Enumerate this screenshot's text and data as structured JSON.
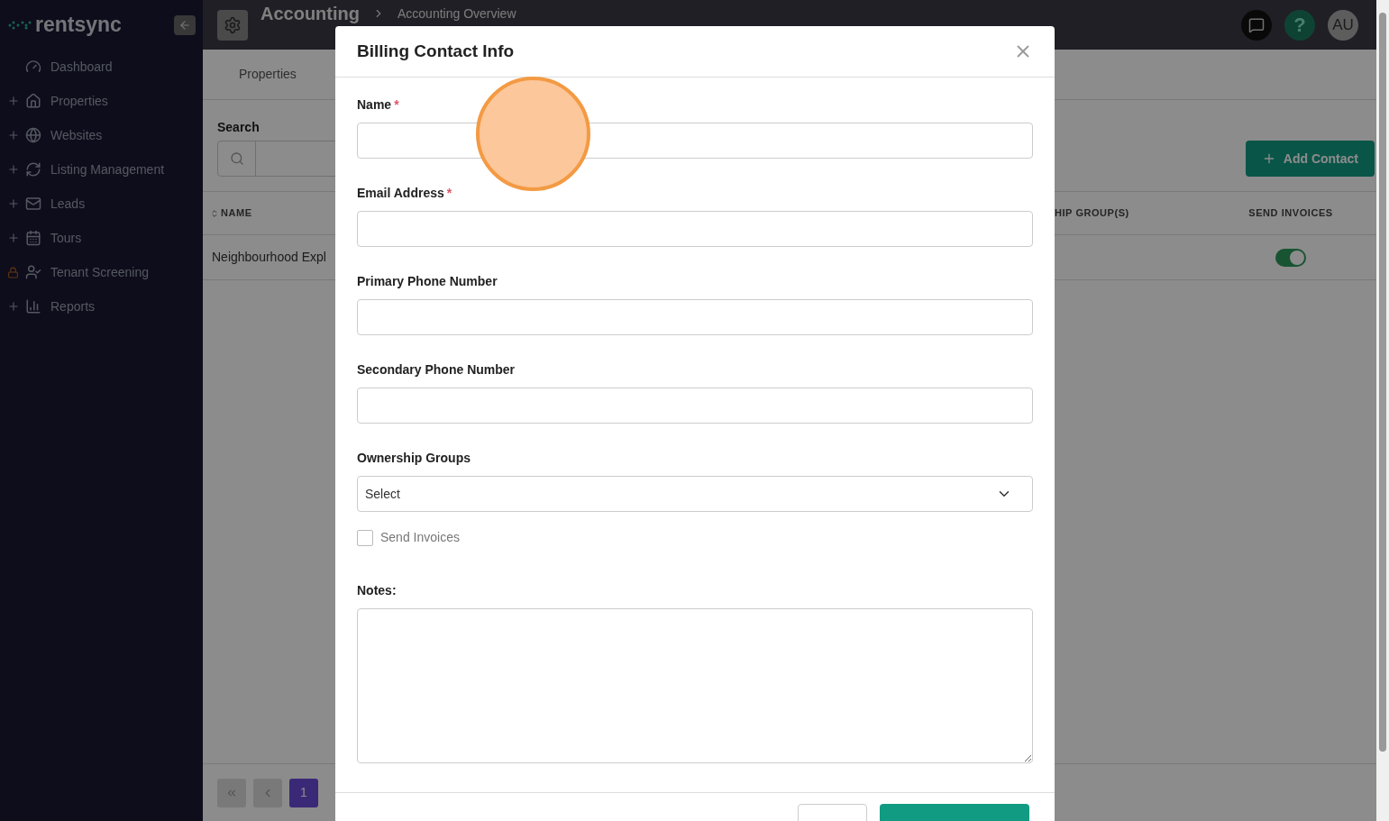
{
  "sidebar": {
    "logo": "rentsync",
    "items": [
      {
        "label": "Dashboard",
        "kind": "plain"
      },
      {
        "label": "Properties",
        "kind": "expandable"
      },
      {
        "label": "Websites",
        "kind": "expandable"
      },
      {
        "label": "Listing Management",
        "kind": "expandable"
      },
      {
        "label": "Leads",
        "kind": "expandable"
      },
      {
        "label": "Tours",
        "kind": "expandable"
      },
      {
        "label": "Tenant Screening",
        "kind": "locked"
      },
      {
        "label": "Reports",
        "kind": "expandable"
      }
    ]
  },
  "header": {
    "title": "Accounting",
    "breadcrumb": "Accounting Overview",
    "help": "?",
    "avatar": "AU"
  },
  "tabs": [
    {
      "label": "Properties",
      "selected": false
    }
  ],
  "search": {
    "label": "Search"
  },
  "add_button": "Add Contact",
  "table": {
    "columns": [
      "NAME",
      "HIP GROUP(S)",
      "SEND INVOICES"
    ],
    "rows": [
      {
        "name": "Neighbourhood Expl",
        "send_invoices": true
      }
    ]
  },
  "pagination": {
    "pages": [
      {
        "label": "1",
        "selected": true
      }
    ]
  },
  "modal": {
    "title": "Billing Contact Info",
    "fields": [
      {
        "label": "Name",
        "required_mark": "*",
        "kind": "input"
      },
      {
        "label": "Email Address",
        "required_mark": "*",
        "kind": "input"
      },
      {
        "label": "Primary Phone Number",
        "kind": "input"
      },
      {
        "label": "Secondary Phone Number",
        "kind": "input"
      },
      {
        "label": "Ownership Groups",
        "kind": "select",
        "placeholder": "Select"
      },
      {
        "label": "Send Invoices",
        "kind": "checkbox",
        "checked": false
      },
      {
        "label": "Notes:",
        "kind": "textarea"
      }
    ],
    "footer_buttons": [
      {
        "kind": "cancel"
      },
      {
        "kind": "save"
      }
    ]
  }
}
